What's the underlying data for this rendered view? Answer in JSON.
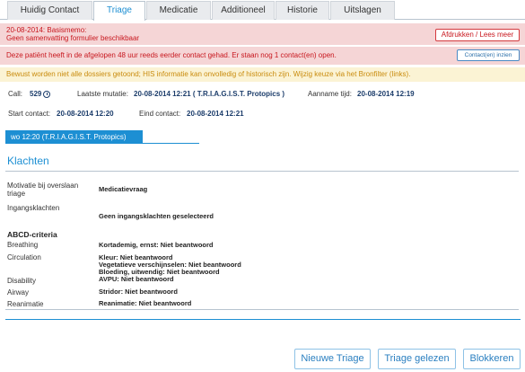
{
  "tabs": [
    {
      "label": "Huidig Contact",
      "active": false
    },
    {
      "label": "Triage",
      "active": true
    },
    {
      "label": "Medicatie",
      "active": false
    },
    {
      "label": "Additioneel",
      "active": false
    },
    {
      "label": "Historie",
      "active": false
    },
    {
      "label": "Uitslagen",
      "active": false
    }
  ],
  "alerts": {
    "memo_line1": "20-08-2014: Basismemo:",
    "memo_line2": "Geen samenvatting formulier beschikbaar",
    "print_button": "Afdrukken / Lees meer",
    "contacts_text": "Deze patiënt heeft in de afgelopen 48 uur reeds eerder contact gehad. Er staan nog 1 contact(en) open.",
    "contacts_button": "Contact(en) inzien",
    "warning_text": "Bewust worden niet alle dossiers getoond; HIS informatie kan onvolledig of historisch zijn. Wijzig keuze via het Bronfilter (links)."
  },
  "info": {
    "call_label": "Call:",
    "call_value": "529",
    "mutatie_label": "Laatste mutatie:",
    "mutatie_value": "20-08-2014 12:21 ( T.R.I.A.G.I.S.T. Protopics )",
    "aanname_label": "Aanname tijd:",
    "aanname_value": "20-08-2014 12:19",
    "start_label": "Start contact:",
    "start_value": "20-08-2014 12:20",
    "eind_label": "Eind contact:",
    "eind_value": "20-08-2014 12:21"
  },
  "subtab": {
    "label": "wo 12:20 (T.R.I.A.G.I.S.T. Protopics)"
  },
  "klachten": {
    "title": "Klachten",
    "motivatie_label_1": "Motivatie bij overslaan",
    "motivatie_label_2": "triage",
    "motivatie_value": "Medicatievraag",
    "ingang_label": "Ingangsklachten",
    "ingang_value": "Geen ingangsklachten geselecteerd"
  },
  "abcd": {
    "title": "ABCD-criteria",
    "breathing_label": "Breathing",
    "breathing_value": "Kortademig, ernst: Niet beantwoord",
    "circulation_label": "Circulation",
    "circulation_value_1": "Kleur: Niet beantwoord",
    "circulation_value_2": "Vegetatieve verschijnselen: Niet beantwoord",
    "circulation_value_3": "Bloeding, uitwendig: Niet beantwoord",
    "disability_label": "Disability",
    "disability_value": "AVPU: Niet beantwoord",
    "airway_label": "Airway",
    "airway_value": "Stridor: Niet beantwoord",
    "reanimatie_label": "Reanimatie",
    "reanimatie_value": "Reanimatie: Niet beantwoord"
  },
  "buttons": {
    "nieuwe": "Nieuwe Triage",
    "gelezen": "Triage gelezen",
    "blokkeren": "Blokkeren"
  },
  "colors": {
    "accent": "#1d8fd3",
    "alert_red": "#c8171e",
    "alert_bg": "#f5d5d6",
    "warn_text": "#c98b0d",
    "warn_bg": "#fbf3d4"
  }
}
